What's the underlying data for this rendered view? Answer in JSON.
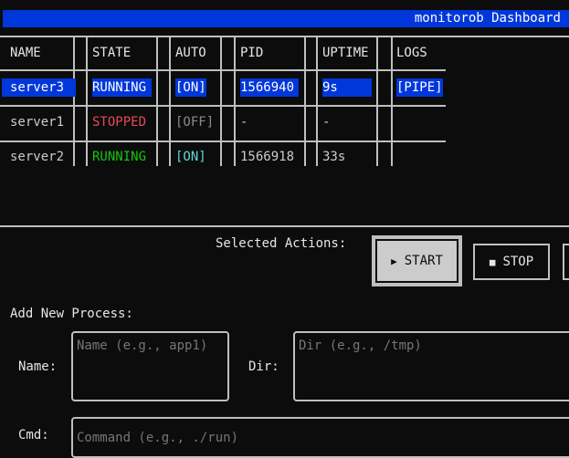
{
  "app": {
    "title": "monitorob Dashboard"
  },
  "table": {
    "headers": [
      "NAME",
      "STATE",
      "AUTO",
      "PID",
      "UPTIME",
      "LOGS"
    ],
    "rows": [
      {
        "name": "server3",
        "state": "RUNNING",
        "auto": "[ON]",
        "pid": "1566940",
        "uptime": "9s",
        "logs": "[PIPE]",
        "selected": true
      },
      {
        "name": "server1",
        "state": "STOPPED",
        "auto": "[OFF]",
        "pid": "-",
        "uptime": "-",
        "logs": ""
      },
      {
        "name": "server2",
        "state": "RUNNING",
        "auto": "[ON]",
        "pid": "1566918",
        "uptime": "33s",
        "logs": ""
      }
    ]
  },
  "actions": {
    "label": "Selected Actions:",
    "start": {
      "icon": "play-icon",
      "glyph": "▶",
      "label": "START"
    },
    "stop": {
      "icon": "stop-icon",
      "glyph": "■",
      "label": "STOP"
    }
  },
  "form": {
    "heading": "Add New Process:",
    "name_label": "Name:",
    "name_placeholder": "Name (e.g., app1)",
    "dir_label": "Dir:",
    "dir_placeholder": "Dir (e.g., /tmp)",
    "cmd_label": "Cmd:",
    "cmd_placeholder": "Command (e.g., ./run)"
  },
  "colors": {
    "accent": "#0037da",
    "running": "#16c60c",
    "stopped": "#e74856",
    "auto_on": "#61d6d6",
    "auto_off": "#8a8a8a"
  }
}
